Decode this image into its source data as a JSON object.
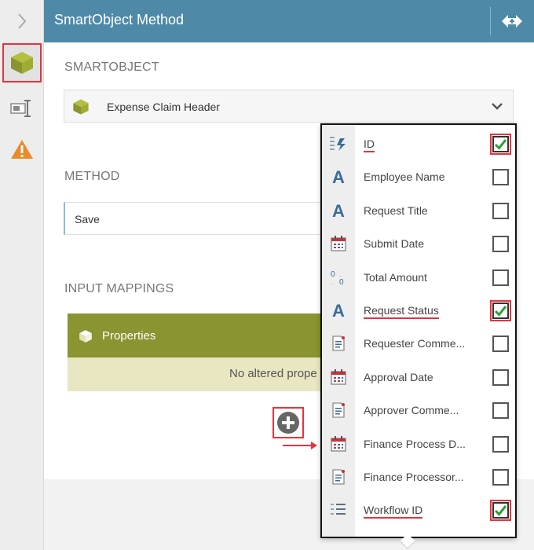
{
  "panel": {
    "title": "SmartObject Method"
  },
  "smartobject": {
    "label": "SMARTOBJECT",
    "selected": "Expense Claim Header"
  },
  "method": {
    "label": "METHOD",
    "selected": "Save"
  },
  "input_mappings": {
    "label": "INPUT MAPPINGS",
    "properties_title": "Properties",
    "empty_text": "No altered prope"
  },
  "properties_list": [
    {
      "label": "ID",
      "type": "autonumber",
      "checked": true
    },
    {
      "label": "Employee Name",
      "type": "text",
      "checked": false
    },
    {
      "label": "Request Title",
      "type": "text",
      "checked": false
    },
    {
      "label": "Submit Date",
      "type": "date",
      "checked": false
    },
    {
      "label": "Total Amount",
      "type": "number",
      "checked": false
    },
    {
      "label": "Request Status",
      "type": "text",
      "checked": true
    },
    {
      "label": "Requester Comme...",
      "type": "memo",
      "checked": false
    },
    {
      "label": "Approval Date",
      "type": "date",
      "checked": false
    },
    {
      "label": "Approver Comme...",
      "type": "memo",
      "checked": false
    },
    {
      "label": "Finance Process D...",
      "type": "date",
      "checked": false
    },
    {
      "label": "Finance Processor...",
      "type": "memo",
      "checked": false
    },
    {
      "label": "Workflow ID",
      "type": "number-list",
      "checked": true
    }
  ],
  "colors": {
    "header": "#4e8aa8",
    "properties_header": "#8a9430",
    "properties_body": "#e9e6c2",
    "highlight": "#e8323f",
    "checkmark": "#2e9e3a"
  }
}
